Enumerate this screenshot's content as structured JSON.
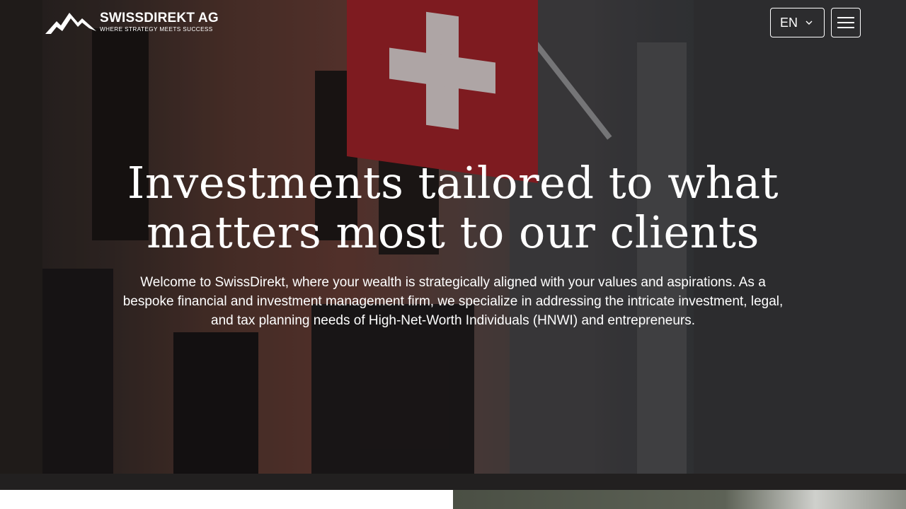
{
  "header": {
    "brand_name": "SWISSDIREKT AG",
    "brand_tagline": "WHERE STRATEGY MEETS SUCCESS",
    "language": "EN",
    "logo_icon": "mountain-peaks-icon",
    "language_icon": "chevron-down-icon",
    "menu_icon": "hamburger-menu-icon"
  },
  "hero": {
    "headline": "Investments tailored to what matters most to our clients",
    "intro": "Welcome to SwissDirekt, where your wealth is strategically aligned with your values and aspirations. As a bespoke financial and investment management firm, we specialize in addressing the intricate investment, legal, and tax planning needs of High-Net-Worth Individuals (HNWI) and entrepreneurs.",
    "text_color": "#ffffff",
    "flag_red": "#a8242b"
  }
}
